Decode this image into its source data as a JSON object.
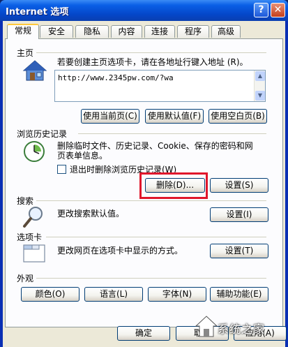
{
  "window": {
    "title": "Internet 选项",
    "help": "?",
    "close": "✕"
  },
  "tabs": [
    "常规",
    "安全",
    "隐私",
    "内容",
    "连接",
    "程序",
    "高级"
  ],
  "home": {
    "label": "主页",
    "description": "若要创建主页选项卡，请在各地址行键入地址 (R)。",
    "url": "http://www.2345pw.com/?wa",
    "use_current": "使用当前页(C)",
    "use_default": "使用默认值(F)",
    "use_blank": "使用空白页(B)"
  },
  "history": {
    "label": "浏览历史记录",
    "description": "删除临时文件、历史记录、Cookie、保存的密码和网页表单信息。",
    "checkbox_label": "退出时删除浏览历史记录(W)",
    "checkbox_checked": false,
    "delete_btn": "删除(D)...",
    "settings_btn": "设置(S)"
  },
  "search": {
    "label": "搜索",
    "description": "更改搜索默认值。",
    "settings_btn": "设置(I)"
  },
  "tabs_section": {
    "label": "选项卡",
    "description": "更改网页在选项卡中显示的方式。",
    "settings_btn": "设置(T)"
  },
  "appearance": {
    "label": "外观",
    "colors_btn": "颜色(O)",
    "languages_btn": "语言(L)",
    "fonts_btn": "字体(N)",
    "accessibility_btn": "辅助功能(E)"
  },
  "footer": {
    "ok": "确定",
    "cancel": "取消",
    "apply": "应用(A)"
  },
  "watermark": {
    "text": "系统之家"
  },
  "colors": {
    "titlebar": "#0a5fe6",
    "dialog_bg": "#ece9d8",
    "highlight": "#e0162b"
  }
}
